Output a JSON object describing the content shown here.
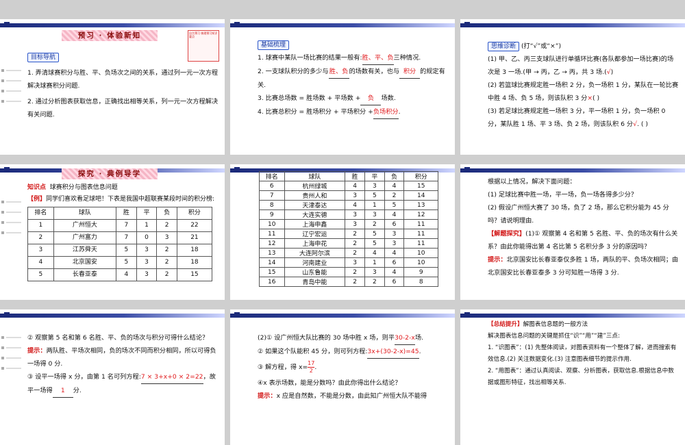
{
  "slide1": {
    "banner": "预习 · 体验新知",
    "nav_title": "目标导航",
    "note_text": "自主预习 梳理预习知识要点",
    "items": [
      "1. 弄清球赛积分与胜、平、负场次之间的关系，通过列一元一次方程解决球赛积分问题.",
      "2. 通过分析图表获取信息，正确找出相等关系，列一元一次方程解决有关问题."
    ]
  },
  "slide2": {
    "tag": "基础梳理",
    "l1_pre": "1. 球赛中某队一场比赛的结果一般有:",
    "l1_ans": "胜、平、负",
    "l1_post": "三种情况.",
    "l2_pre": "2. 一支球队积分的多少与",
    "l2_ans1": "胜、负",
    "l2_mid": "的场数有关，也与",
    "l2_ans2": "积分",
    "l2_post": "的规定有关.",
    "l3_pre": "3. 比赛总场数 = 胜场数 + 平场数 +",
    "l3_ans": "负",
    "l3_post": "场数.",
    "l4_pre": "4. 比赛总积分 = 胜场积分 + 平场积分 +",
    "l4_ans": "负场积分",
    "l4_post": "."
  },
  "slide3": {
    "tag": "思维诊断",
    "tag_after": "(打“√”或“×”)",
    "l1": "(1) 甲、乙、丙三支球队进行单循环比赛(各队都参加一场比赛)的场次是 3 一场.(甲 → 丙，乙 → 丙，共 3 场.(",
    "l1_mark": "√",
    "l1_end": ")",
    "l2": "(2) 若篮球比赛规定胜一场积 2 分，负一场积 1 分，某队在一轮比赛中胜 4 场、负 5 场，则该队积 3 分",
    "l2_mark": "×",
    "l2_end": "(    )",
    "l3": "(3) 若足球比赛规定胜一场积 3 分，平一场积 1 分，负一场积 0 分，某队胜 1 场、平 3 场、负 2 场，则该队积 6 分",
    "l3_mark": "√",
    "l3_end": ". (    )"
  },
  "slide4": {
    "banner": "探究 · 典例导学",
    "kp_label": "知识点",
    "kp_text": "球赛积分与图表信息问题",
    "ex_label": "【例】",
    "ex_text": "同学们喜欢看足球吧！下表是我国中超联赛某段时间的积分榜:",
    "headers": [
      "排名",
      "球队",
      "胜",
      "平",
      "负",
      "积分"
    ],
    "rows": [
      [
        "1",
        "广州恒大",
        "7",
        "1",
        "2",
        "22"
      ],
      [
        "2",
        "广州富力",
        "7",
        "0",
        "3",
        "21"
      ],
      [
        "3",
        "江苏舜天",
        "5",
        "3",
        "2",
        "18"
      ],
      [
        "4",
        "北京国安",
        "5",
        "3",
        "2",
        "18"
      ],
      [
        "5",
        "长春亚泰",
        "4",
        "3",
        "2",
        "15"
      ]
    ]
  },
  "slide5": {
    "headers": [
      "排名",
      "球队",
      "胜",
      "平",
      "负",
      "积分"
    ],
    "rows": [
      [
        "6",
        "杭州绿城",
        "4",
        "3",
        "4",
        "15"
      ],
      [
        "7",
        "贵州人和",
        "3",
        "5",
        "2",
        "14"
      ],
      [
        "8",
        "天津泰达",
        "4",
        "1",
        "5",
        "13"
      ],
      [
        "9",
        "大连实德",
        "3",
        "3",
        "4",
        "12"
      ],
      [
        "10",
        "上海申鑫",
        "3",
        "2",
        "6",
        "11"
      ],
      [
        "11",
        "辽宁宏运",
        "2",
        "5",
        "3",
        "11"
      ],
      [
        "12",
        "上海申花",
        "2",
        "5",
        "3",
        "11"
      ],
      [
        "13",
        "大连阿尔滨",
        "2",
        "4",
        "4",
        "10"
      ],
      [
        "14",
        "河南建业",
        "3",
        "1",
        "6",
        "10"
      ],
      [
        "15",
        "山东鲁能",
        "2",
        "3",
        "4",
        "9"
      ],
      [
        "16",
        "青岛中能",
        "2",
        "2",
        "6",
        "8"
      ]
    ]
  },
  "slide6": {
    "intro": "根据以上情况，解决下面问题：",
    "q1": "(1) 足球比赛中胜一场，平一场，负一场各得多少分？",
    "q2": "(2) 假设广州恒大赛了 30 场，负了 2 场，那么它积分能为 45 分吗？请说明理由.",
    "tip_label": "【解题探究】",
    "tip_text": "(1)① 观察第 4 名和第 5 名胜、平、负的场次有什么关系？由此你能得出第 4 名比第 5 名积分多 3 分的原因吗？",
    "hint_label": "提示：",
    "hint_text": "北京国安比长春亚泰仅多胜 1 场，两队的平、负场次相同；由北京国安比长春亚泰多 3 分可知胜一场得 3 分."
  },
  "slide7": {
    "q": "② 观察第 5 名和第 6 名胜、平、负的场次与积分可得什么结论？",
    "hint_label": "提示：",
    "hint_text": "两队胜、平场次相同，负的场次不同而积分相同，所以可得负一场得 0 分.",
    "l3_pre": "③ 设平一场得 x 分，由第 1 名可列方程:",
    "l3_ans": "7 × 3+x+0 × 2=22",
    "l3_post": "，故平一场得",
    "l4_ans": "1",
    "l4_post": "分."
  },
  "slide8": {
    "l1_pre": "(2)① 设广州恒大队比赛的 30 场中胜 x 场，则平",
    "l1_ans": "30-2-x",
    "l1_post": "场.",
    "l2_pre": "② 如果这个队能积 45 分，则可列方程:",
    "l2_ans": "3x+(30-2-x)=45",
    "l2_post": ".",
    "l3_pre": "③ 解方程，得 x=",
    "l3_num": "17",
    "l3_den": "2",
    "l3_post": ".",
    "l4": "④x 表示场数，能是分数吗？由此你得出什么结论？",
    "hint_label": "提示：",
    "hint_text": "x 应是自然数，不能是分数，由此知广州恒大队不能得"
  },
  "slide9": {
    "label": "【总结提升】",
    "title": "解图表信息题的一般方法",
    "l1": "解决图表信息问题的关键是抓住“识”“用”“建”三点:",
    "l2": "1. “识图表”：(1) 先整体阅读，对图表资料有一个整体了解，进而搜索有效信息.(2) 关注数据变化.(3) 注意图表细节的提示作用.",
    "l3": "2. “用图表”：通过认真阅读、观察、分析图表，获取信息.根据信息中数据或图形特征，找出相等关系."
  }
}
